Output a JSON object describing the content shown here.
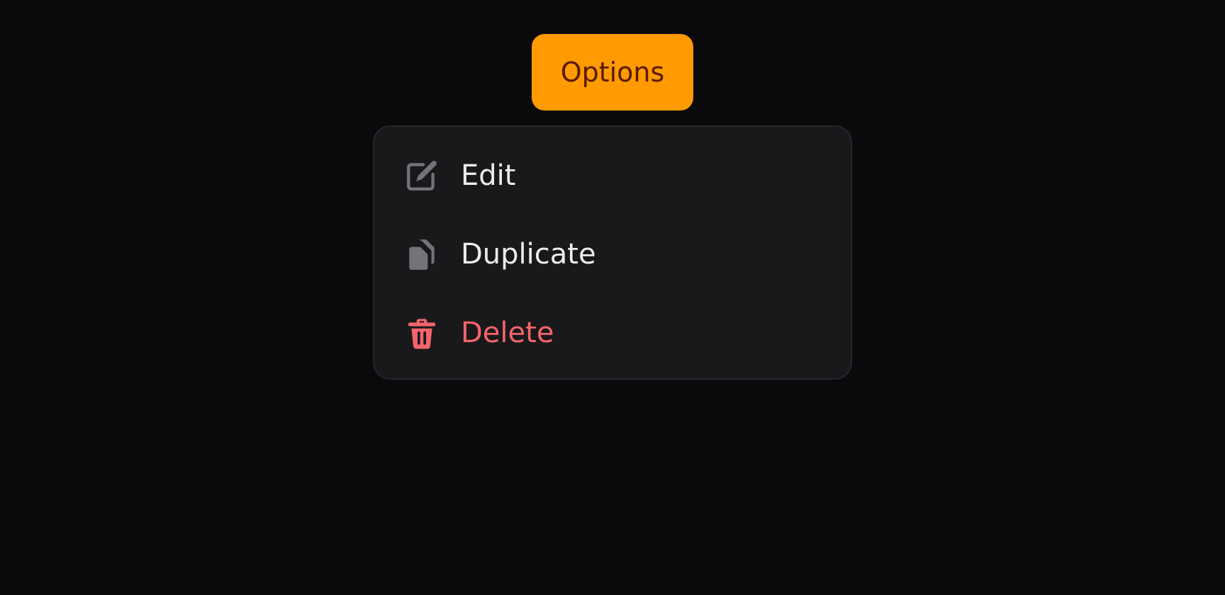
{
  "trigger": {
    "label": "Options",
    "color": "#ff9a00",
    "text_color": "#5a1a06"
  },
  "menu": {
    "items": [
      {
        "label": "Edit",
        "icon": "edit-icon"
      },
      {
        "label": "Duplicate",
        "icon": "duplicate-icon"
      },
      {
        "label": "Delete",
        "icon": "trash-icon",
        "color": "#f4646c"
      }
    ]
  },
  "colors": {
    "background": "#0a0a0c",
    "menu_background": "#19191b",
    "icon_muted": "#737378",
    "danger": "#f4646c"
  }
}
